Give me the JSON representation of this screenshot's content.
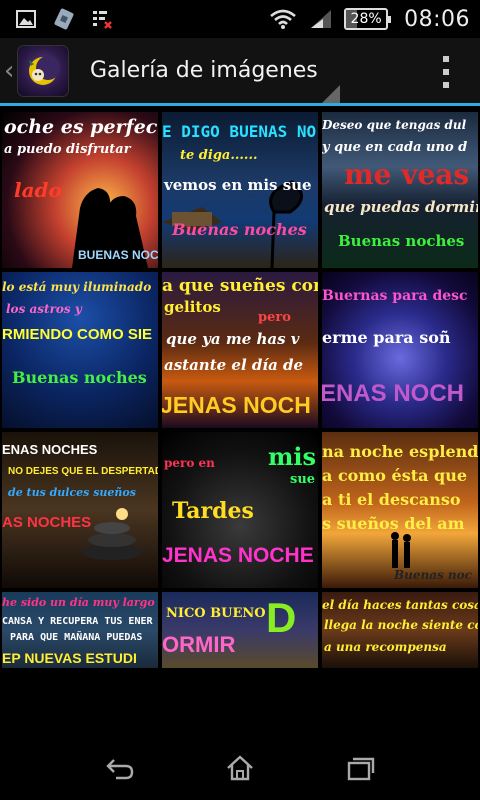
{
  "status_bar": {
    "battery_percent": "28%",
    "battery_level": 0.28,
    "time": "08:06",
    "icons": [
      "image-notification-icon",
      "sim-app-icon",
      "task-list-icon",
      "wifi-icon",
      "signal-icon",
      "battery-icon"
    ]
  },
  "action_bar": {
    "title": "Galería de imágenes",
    "icons": [
      "up-caret-icon",
      "app-logo-icon",
      "overflow-menu-icon"
    ]
  },
  "gallery": {
    "thumbnails": [
      {
        "lines": [
          "oche es perfecta",
          "a puedo disfrutar",
          "lado",
          "BUENAS NOC"
        ]
      },
      {
        "lines": [
          "E DIGO BUENAS NO",
          "te diga......",
          "vemos en mis sue",
          "Buenas noches"
        ]
      },
      {
        "lines": [
          "Deseo que tengas dul",
          "y que en cada uno d",
          "me veas",
          "que puedas dormir",
          "Buenas noches"
        ]
      },
      {
        "lines": [
          "lo está muy iluminado",
          "los astros y",
          "RMIENDO COMO SIE",
          "Buenas noches"
        ]
      },
      {
        "lines": [
          "a que sueñes con",
          "gelitos",
          "pero",
          "que ya me has v",
          "astante el día de",
          "JENAS NOCH"
        ]
      },
      {
        "lines": [
          "Buernas para desc",
          "erme para soñ",
          "ENAS NOCH"
        ]
      },
      {
        "lines": [
          "ENAS NOCHES",
          "NO DEJES QUE EL DESPERTAD",
          "de tus dulces sueños",
          "AS NOCHES"
        ]
      },
      {
        "lines": [
          "pero en",
          "mis",
          "sue",
          "Tardes",
          "JENAS NOCHE"
        ]
      },
      {
        "lines": [
          "na noche esplend",
          "a como ésta que",
          "a ti el descanso",
          "s sueños del am",
          "Buenas noc"
        ]
      },
      {
        "lines": [
          "he sido un día muy largo pu",
          "CANSA Y RECUPERA TUS ENER",
          "PARA QUE MAÑANA PUEDAS",
          "EP NUEVAS ESTUDI"
        ]
      },
      {
        "lines": [
          "NICO BUENO",
          "ORMIR",
          "D"
        ]
      },
      {
        "lines": [
          "el día haces tantas cosas",
          "llega la noche siente com",
          "a una recompensa"
        ]
      }
    ]
  },
  "nav_bar": {
    "icons": [
      "back-icon",
      "home-icon",
      "recent-apps-icon"
    ]
  },
  "colors": {
    "accent": "#33aadd",
    "background": "#000000",
    "action_bar": "#121212"
  }
}
